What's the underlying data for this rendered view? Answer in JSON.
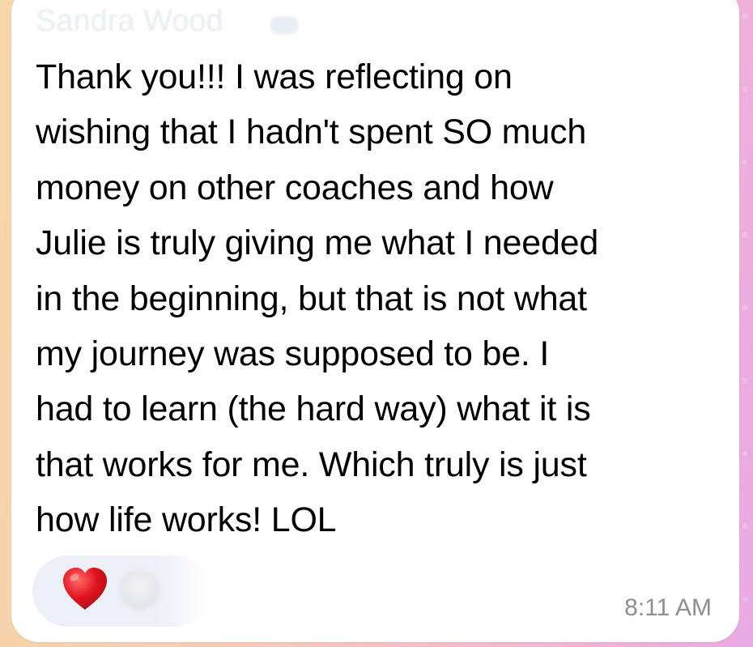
{
  "message": {
    "sender_name": "Sandra Wood",
    "lines": [
      "Thank you!!! I was reflecting on",
      "wishing that I hadn't spent SO much",
      "money on other coaches and how",
      "Julie is truly giving me what I needed",
      "in the beginning, but that is not what",
      "my journey was supposed to be. I",
      "had to learn (the hard way) what it is",
      "that works for me. Which truly is just",
      "how life works! LOL"
    ],
    "timestamp": "8:11 AM"
  },
  "reactions": {
    "items": [
      {
        "icon": "red-heart-icon",
        "emoji": "❤️"
      },
      {
        "icon": "reactor-avatar-icon"
      }
    ]
  },
  "colors": {
    "bubble_bg": "#ffffff",
    "text": "#000000",
    "timestamp": "#8e8e93",
    "reaction_pill": "#eef0f8",
    "heart": "#e0141e"
  }
}
